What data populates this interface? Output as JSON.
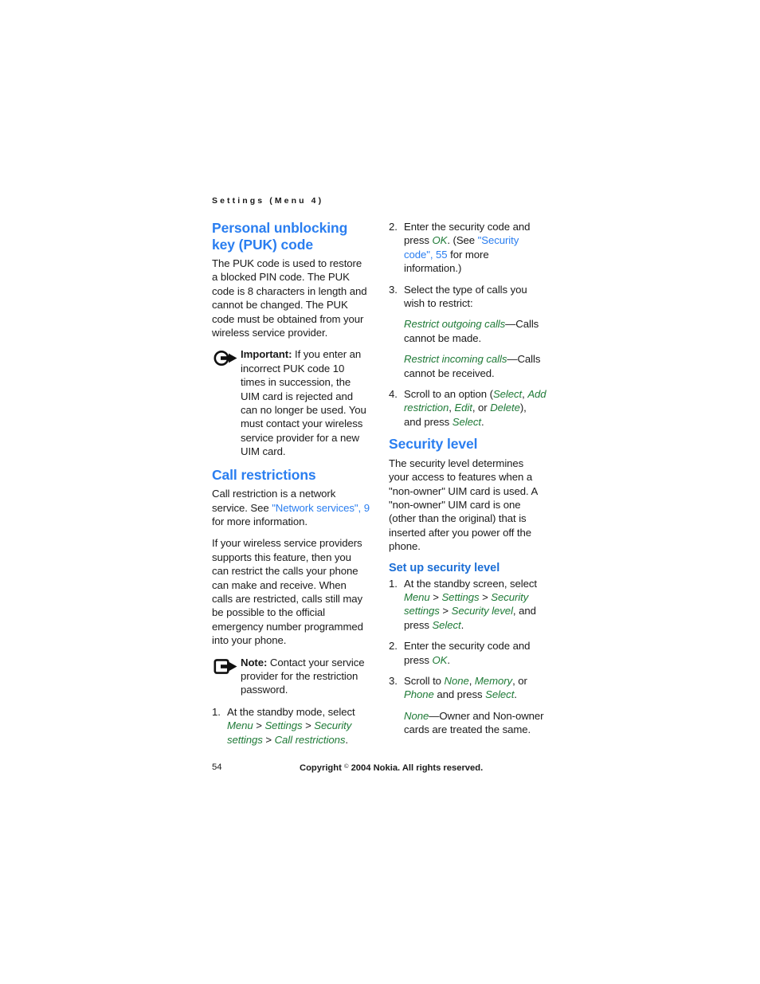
{
  "header": {
    "running_head": "Settings (Menu 4)"
  },
  "left_column": {
    "puk": {
      "heading": "Personal unblocking key (PUK) code",
      "paragraph": "The PUK code is used to restore a blocked PIN code. The PUK code is 8 characters in length and cannot be changed. The PUK code must be obtained from your wireless service provider.",
      "important": {
        "icon": "important-arrow-circle-icon",
        "label": "Important:",
        "text": " If you enter an incorrect PUK code 10 times in succession, the UIM card is rejected and can no longer be used. You must contact your wireless service provider for a new UIM card."
      }
    },
    "call_restrictions": {
      "heading": "Call restrictions",
      "paragraph_1_before": "Call restriction is a network service. See ",
      "paragraph_1_link": "\"Network services\", 9",
      "paragraph_1_after": " for more information.",
      "paragraph_2": "If your wireless service providers supports this feature, then you can restrict the calls your phone can make and receive. When calls are restricted, calls still may be possible to the official emergency number programmed into your phone.",
      "note": {
        "icon": "note-square-arrow-icon",
        "label": "Note:",
        "text": " Contact your service provider for the restriction password."
      },
      "step_1": {
        "num": "1.",
        "text_before": "At the standby mode, select ",
        "path": [
          "Menu",
          "Settings",
          "Security settings",
          "Call restrictions"
        ],
        "separator": " > ",
        "text_after": "."
      }
    }
  },
  "right_column": {
    "call_restrictions_cont": {
      "step_2": {
        "num": "2.",
        "t1": "Enter the security code and press ",
        "ui1": "OK",
        "t2": ". (See ",
        "link": "\"Security code\", 55",
        "t3": " for more information.)"
      },
      "step_3": {
        "num": "3.",
        "text": "Select the type of calls you wish to restrict:"
      },
      "def_outgoing": {
        "term": "Restrict outgoing calls",
        "def": "—Calls cannot be made."
      },
      "def_incoming": {
        "term": "Restrict incoming calls",
        "def": "—Calls cannot be received."
      },
      "step_4": {
        "num": "4.",
        "t1": "Scroll to an option (",
        "ui1": "Select",
        "t2": ", ",
        "ui2": "Add restriction",
        "t3": ", ",
        "ui3": "Edit",
        "t4": ", or ",
        "ui4": "Delete",
        "t5": "), and press ",
        "ui5": "Select",
        "t6": "."
      }
    },
    "security_level": {
      "heading": "Security level",
      "paragraph": "The security level determines your access to features when a \"non-owner\" UIM card is used. A \"non-owner\" UIM card is one (other than the original) that is inserted after you power off the phone.",
      "subheading": "Set up security level",
      "step_1": {
        "num": "1.",
        "t1": "At the standby screen, select ",
        "path": [
          "Menu",
          "Settings",
          "Security settings",
          "Security level"
        ],
        "separator": " > ",
        "t2": ", and press ",
        "ui1": "Select",
        "t3": "."
      },
      "step_2": {
        "num": "2.",
        "t1": "Enter the security code and press ",
        "ui1": "OK",
        "t2": "."
      },
      "step_3": {
        "num": "3.",
        "t1": "Scroll to ",
        "ui1": "None",
        "t2": ", ",
        "ui2": "Memory",
        "t3": ", or ",
        "ui3": "Phone",
        "t4": " and press ",
        "ui4": "Select",
        "t5": "."
      },
      "def_none": {
        "term": "None",
        "def": "—Owner and Non-owner cards are treated the same."
      }
    }
  },
  "footer": {
    "page_number": "54",
    "copyright_before": "Copyright ",
    "copyright_symbol": "©",
    "copyright_after": " 2004 Nokia. All rights reserved."
  },
  "colors": {
    "heading_blue": "#2a7ef0",
    "subheading_blue": "#1b6ed6",
    "ui_green": "#1f7a37",
    "body_black": "#1a1a1a",
    "page_white": "#ffffff"
  }
}
